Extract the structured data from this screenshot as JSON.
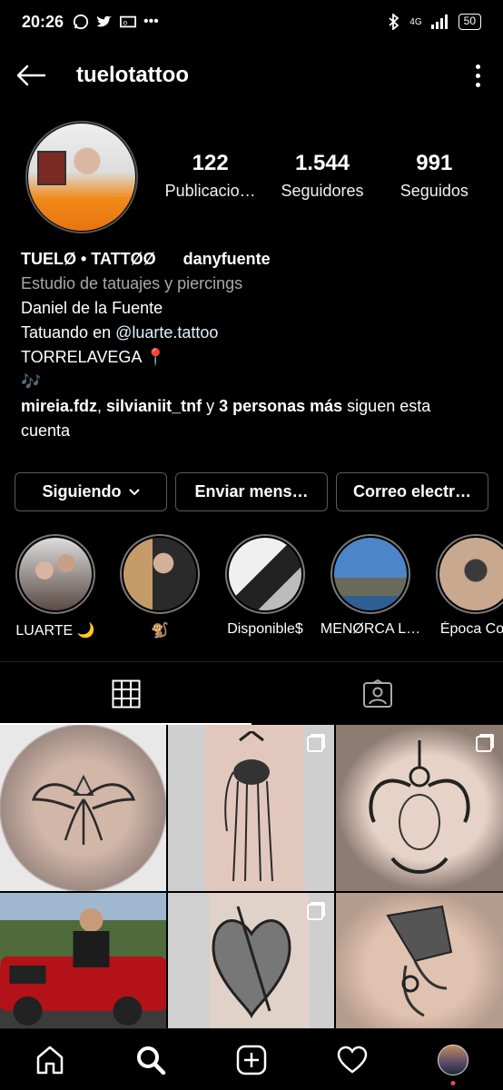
{
  "status_bar": {
    "time": "20:26",
    "left_icons": [
      "whatsapp-icon",
      "twitter-icon",
      "outlook-icon",
      "more-notifications-icon"
    ],
    "network": "4G",
    "battery": "50"
  },
  "header": {
    "username": "tuelotattoo"
  },
  "profile": {
    "stats": [
      {
        "value": "122",
        "label": "Publicacio…"
      },
      {
        "value": "1.544",
        "label": "Seguidores"
      },
      {
        "value": "991",
        "label": "Seguidos"
      }
    ],
    "name": "TUELØ • TATTØØ",
    "secondary_handle": "danyfuente",
    "category": "Estudio de tatuajes y piercings",
    "bio_line1": "Daniel de la Fuente",
    "bio_line2_prefix": "Tatuando en ",
    "bio_line2_link": "@luarte.tattoo",
    "bio_line3": "TORRELAVEGA 📍",
    "bio_line4": "🎶",
    "followed_by_user1": "mireia.fdz",
    "followed_by_sep1": ", ",
    "followed_by_user2": "silvianiit_tnf",
    "followed_by_and": " y ",
    "followed_by_more": "3 personas más",
    "followed_by_suffix": " siguen esta cuenta"
  },
  "buttons": {
    "following": "Siguiendo",
    "message": "Enviar mens…",
    "email": "Correo electr…"
  },
  "highlights": [
    {
      "label": "LUARTE 🌙",
      "colors": [
        "#cfcfcf",
        "#6b5a50"
      ]
    },
    {
      "label": "🐒",
      "colors": [
        "#c59b6a",
        "#2a2a2a"
      ]
    },
    {
      "label": "Disponible$",
      "colors": [
        "#f0f0f0",
        "#222222"
      ]
    },
    {
      "label": "MENØRCA L…",
      "colors": [
        "#3a6fb0",
        "#4a4a40"
      ]
    },
    {
      "label": "Época Cov",
      "colors": [
        "#c9a890",
        "#3a3a3a"
      ]
    }
  ],
  "tabs": [
    {
      "name": "grid-tab",
      "icon": "grid-icon"
    },
    {
      "name": "tagged-tab",
      "icon": "tagged-icon"
    }
  ],
  "posts": [
    {
      "id": 1,
      "multi": false,
      "subject": "winged-tattoo"
    },
    {
      "id": 2,
      "multi": true,
      "subject": "elephant-tattoo"
    },
    {
      "id": 3,
      "multi": true,
      "subject": "baphomet-tattoo"
    },
    {
      "id": 4,
      "multi": false,
      "subject": "red-car-photo"
    },
    {
      "id": 5,
      "multi": true,
      "subject": "heart-tattoo"
    },
    {
      "id": 6,
      "multi": false,
      "subject": "nefertiti-tattoo"
    }
  ],
  "bottom_nav": [
    "home-icon",
    "search-icon",
    "new-post-icon",
    "activity-icon",
    "profile-avatar"
  ]
}
